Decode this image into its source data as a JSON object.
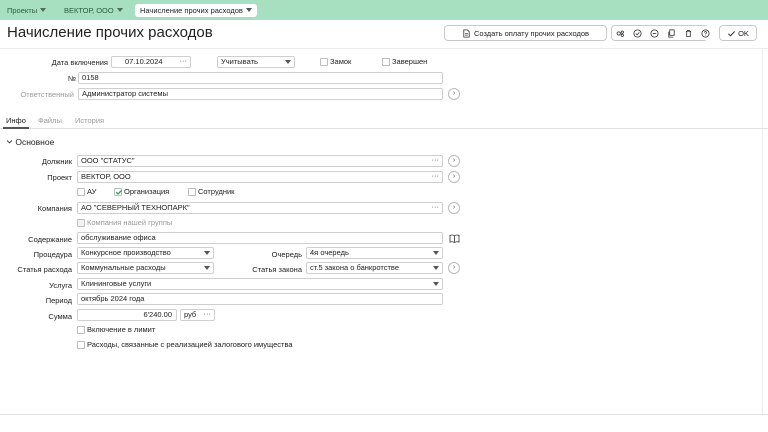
{
  "breadcrumbs": [
    {
      "label": "Проекты"
    },
    {
      "label": "ВЕКТОР, ООО"
    },
    {
      "label": "Начисление прочих расходов"
    }
  ],
  "page_title": "Начисление прочих расходов",
  "toolbar": {
    "create_payment_label": "Создать оплату прочих расходов",
    "ok_label": "OK",
    "icons": [
      "link-icon",
      "check-circle-icon",
      "minus-circle-icon",
      "copy-icon",
      "trash-icon",
      "help-icon"
    ]
  },
  "header": {
    "date_label": "Дата включения",
    "date_value": "07.10.2024",
    "account_select": "Учитывать",
    "lock_label": "Замок",
    "finished_label": "Завершен",
    "number_label": "№",
    "number_value": "0158",
    "responsible_label": "Ответственный",
    "responsible_value": "Администратор системы"
  },
  "tabs": [
    {
      "label": "Инфо",
      "active": true
    },
    {
      "label": "Файлы",
      "active": false
    },
    {
      "label": "История",
      "active": false
    }
  ],
  "section_title": "Основное",
  "form": {
    "debtor_label": "Должник",
    "debtor_value": "ООО \"СТАТУС\"",
    "project_label": "Проект",
    "project_value": "ВЕКТОР, ООО",
    "check_au": "АУ",
    "check_org": "Организация",
    "check_employee": "Сотрудник",
    "company_label": "Компания",
    "company_value": "АО \"СЕВЕРНЫЙ ТЕХНОПАРК\"",
    "own_company_label": "Компания нашей группы",
    "content_label": "Содержание",
    "content_value": "обслуживание офиса",
    "procedure_label": "Процедура",
    "procedure_value": "Конкурсное производство",
    "queue_label": "Очередь",
    "queue_value": "4я очередь",
    "expense_label": "Статья расхода",
    "expense_value": "Коммунальные расходы",
    "law_label": "Статья закона",
    "law_value": "ст.5 закона о банкротстве",
    "service_label": "Услуга",
    "service_value": "Клининговые услуги",
    "period_label": "Период",
    "period_value": "октябрь 2024 года",
    "sum_label": "Сумма",
    "sum_value": "6'240.00",
    "currency_value": "руб",
    "include_limit_label": "Включение в лимит",
    "collateral_label": "Расходы, связанные с реализацией залогового имущества"
  },
  "colors": {
    "topbar": "#a6e0c0",
    "check": "#3a9a5c"
  }
}
